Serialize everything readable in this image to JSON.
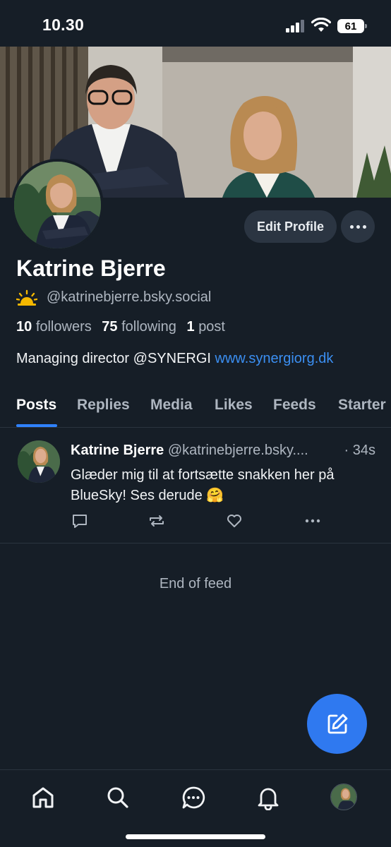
{
  "status_bar": {
    "time": "10.30",
    "battery": "61"
  },
  "profile": {
    "display_name": "Katrine Bjerre",
    "handle": "@katrinebjerre.bsky.social",
    "followers_count": "10",
    "followers_label": "followers",
    "following_count": "75",
    "following_label": "following",
    "posts_count": "1",
    "posts_label": "post",
    "bio_text": "Managing director @SYNERGI ",
    "bio_link": "www.synergiorg.dk",
    "edit_label": "Edit Profile"
  },
  "tabs": [
    {
      "label": "Posts"
    },
    {
      "label": "Replies"
    },
    {
      "label": "Media"
    },
    {
      "label": "Likes"
    },
    {
      "label": "Feeds"
    },
    {
      "label": "Starter"
    }
  ],
  "post": {
    "author": "Katrine Bjerre",
    "handle": "@katrinebjerre.bsky....",
    "time": "· 34s",
    "text": "Glæder mig til at fortsætte snakken her på BlueSky! Ses derude 🤗"
  },
  "feed_end": "End of feed",
  "colors": {
    "background": "#161e27",
    "accent": "#2f79f0",
    "link": "#3b8ff2",
    "muted": "#aeb6c0"
  },
  "icons": [
    "sun-icon",
    "reply-icon",
    "repost-icon",
    "like-icon",
    "more-icon",
    "compose-icon",
    "home-icon",
    "search-icon",
    "chat-icon",
    "bell-icon"
  ]
}
